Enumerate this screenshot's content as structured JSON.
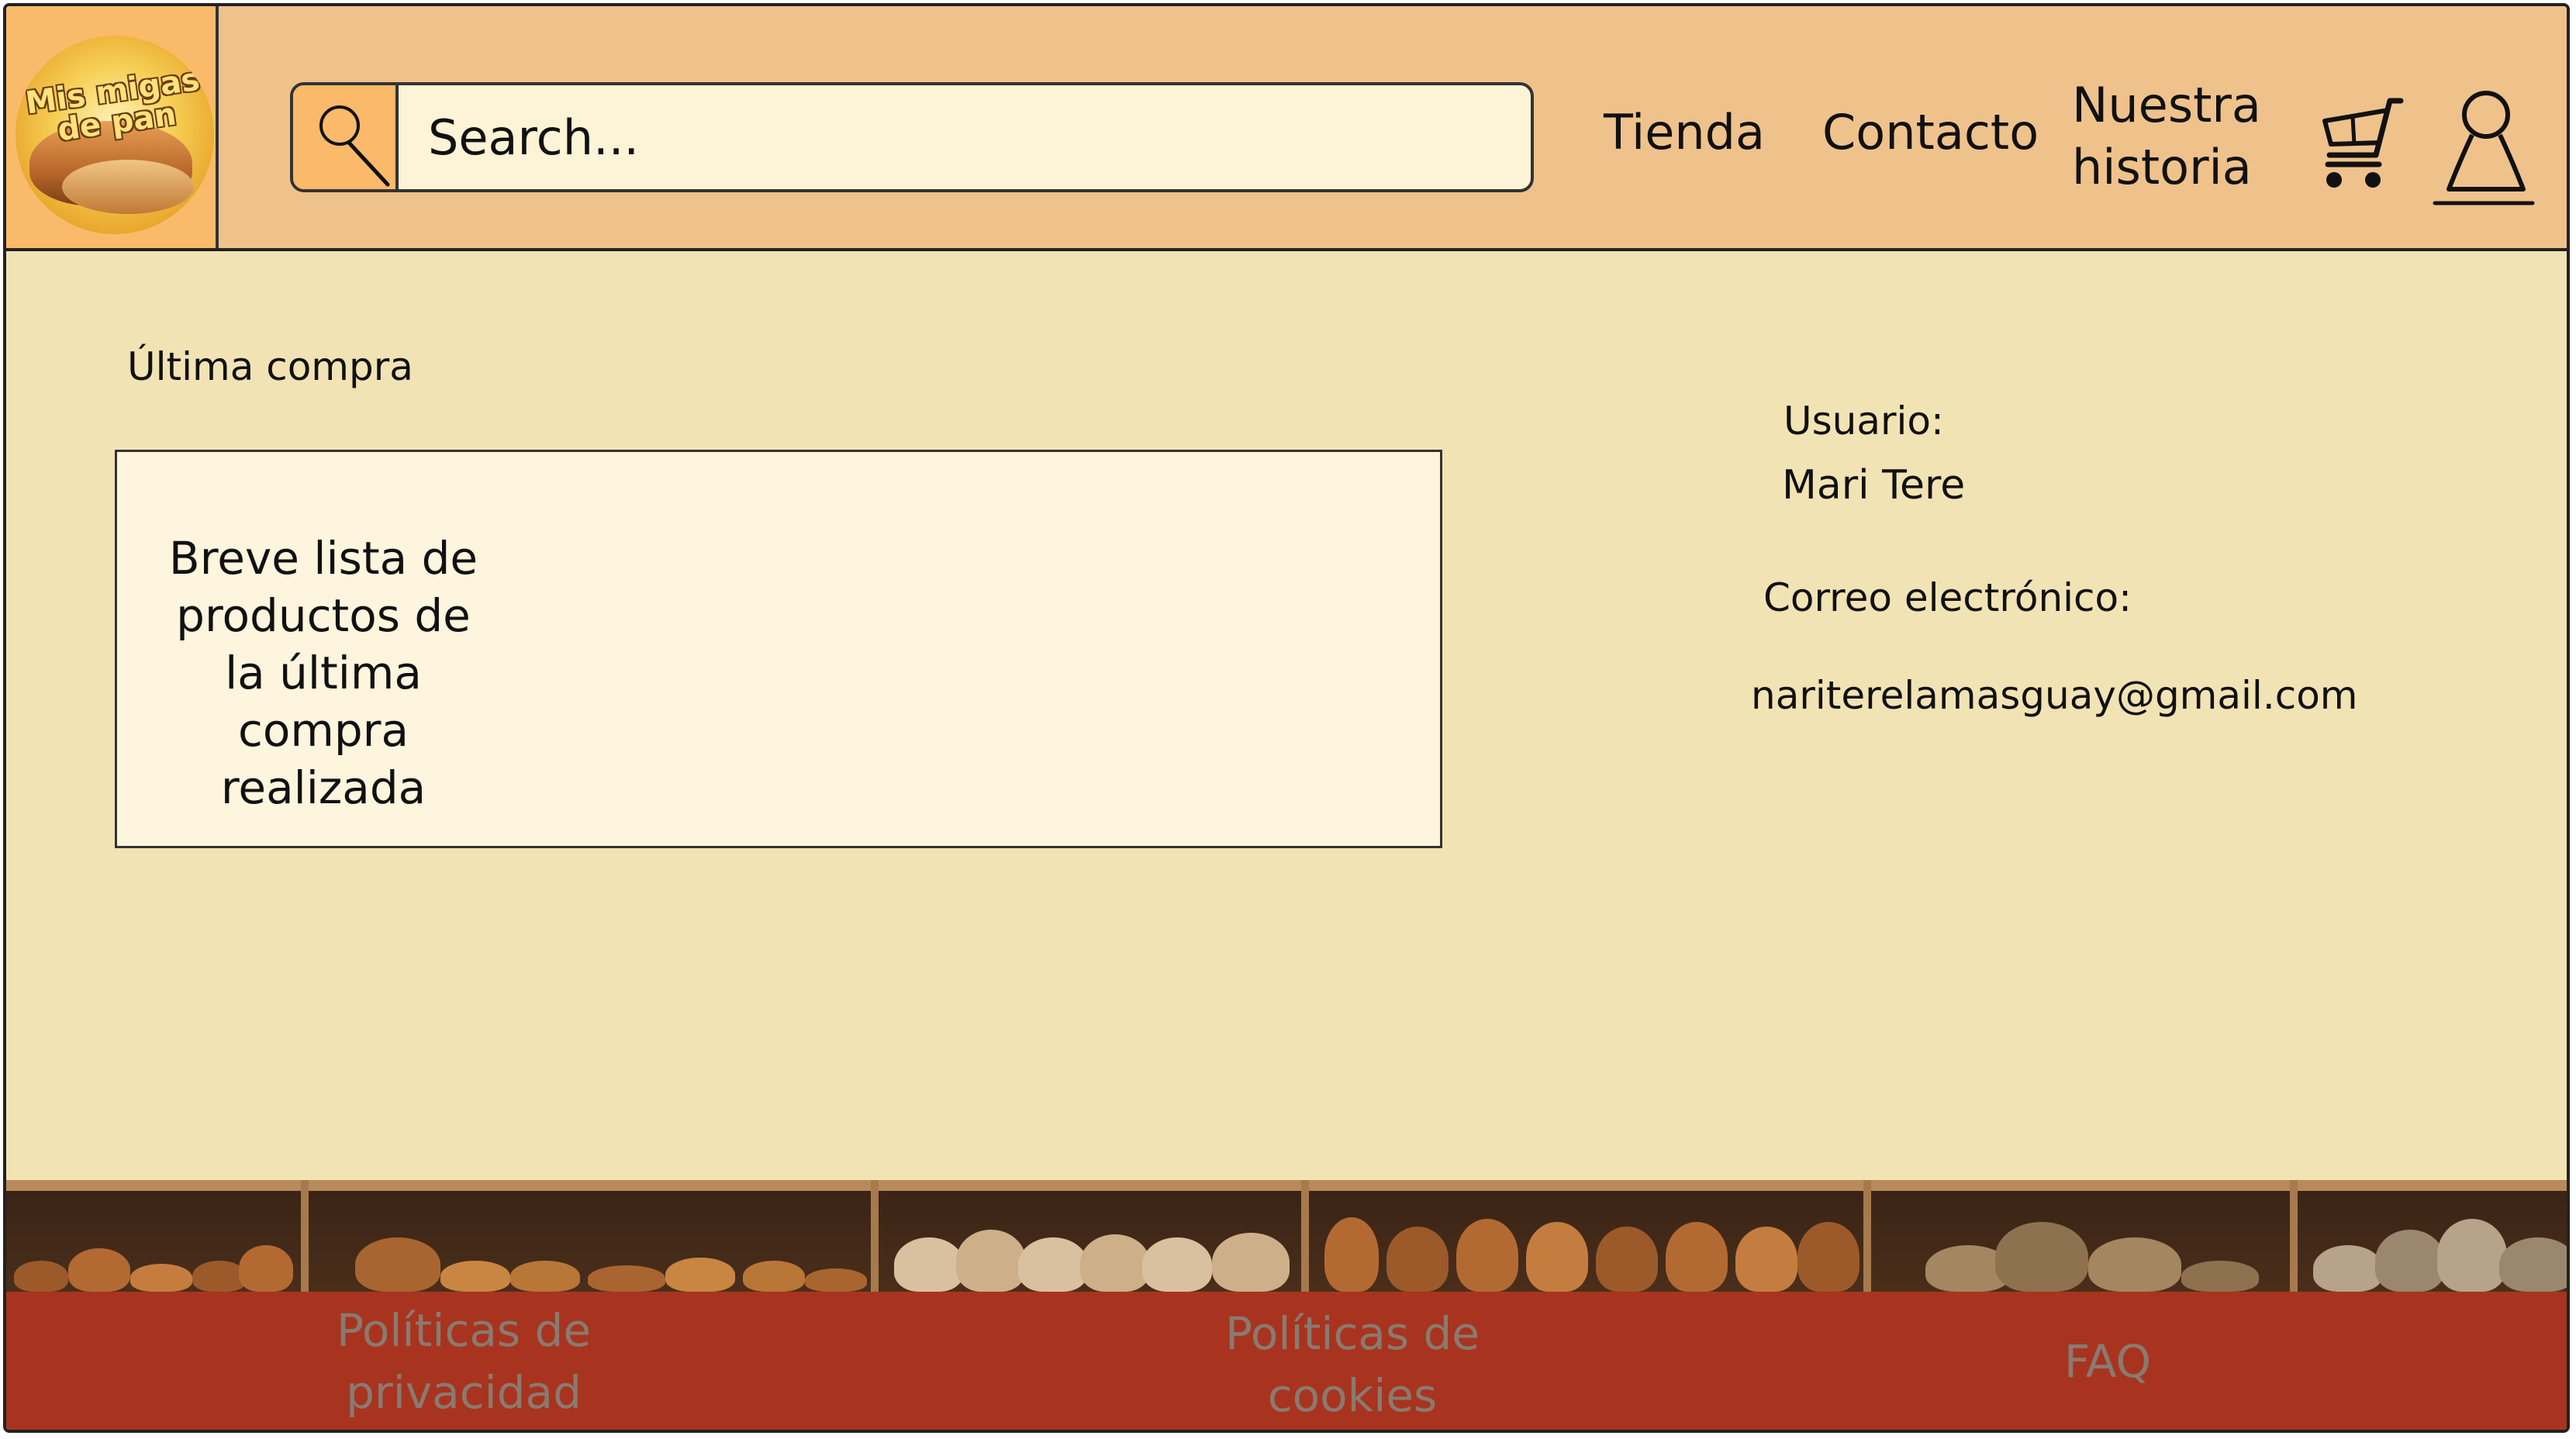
{
  "header": {
    "logo_text": "Mis migas de pan",
    "search": {
      "placeholder": "Search..."
    },
    "nav": {
      "tienda": "Tienda",
      "contacto": "Contacto",
      "historia": "Nuestra historia"
    },
    "icons": {
      "search": "search-icon",
      "cart": "cart-icon",
      "user": "user-icon"
    }
  },
  "main": {
    "last_purchase_title": "Última compra",
    "last_purchase_text": "Breve lista de productos de la última compra realizada",
    "user": {
      "label": "Usuario:",
      "name": "Mari Tere",
      "email_label": "Correo electrónico:",
      "email": "nariterelamasguay@gmail.com"
    }
  },
  "footer": {
    "privacy": "Políticas de privacidad",
    "cookies": "Políticas de cookies",
    "faq": "FAQ"
  },
  "colors": {
    "header_bg": "#efc28c",
    "main_bg": "#f2e3b5",
    "footer_bg": "#a8341f",
    "accent": "#fbb96a"
  }
}
